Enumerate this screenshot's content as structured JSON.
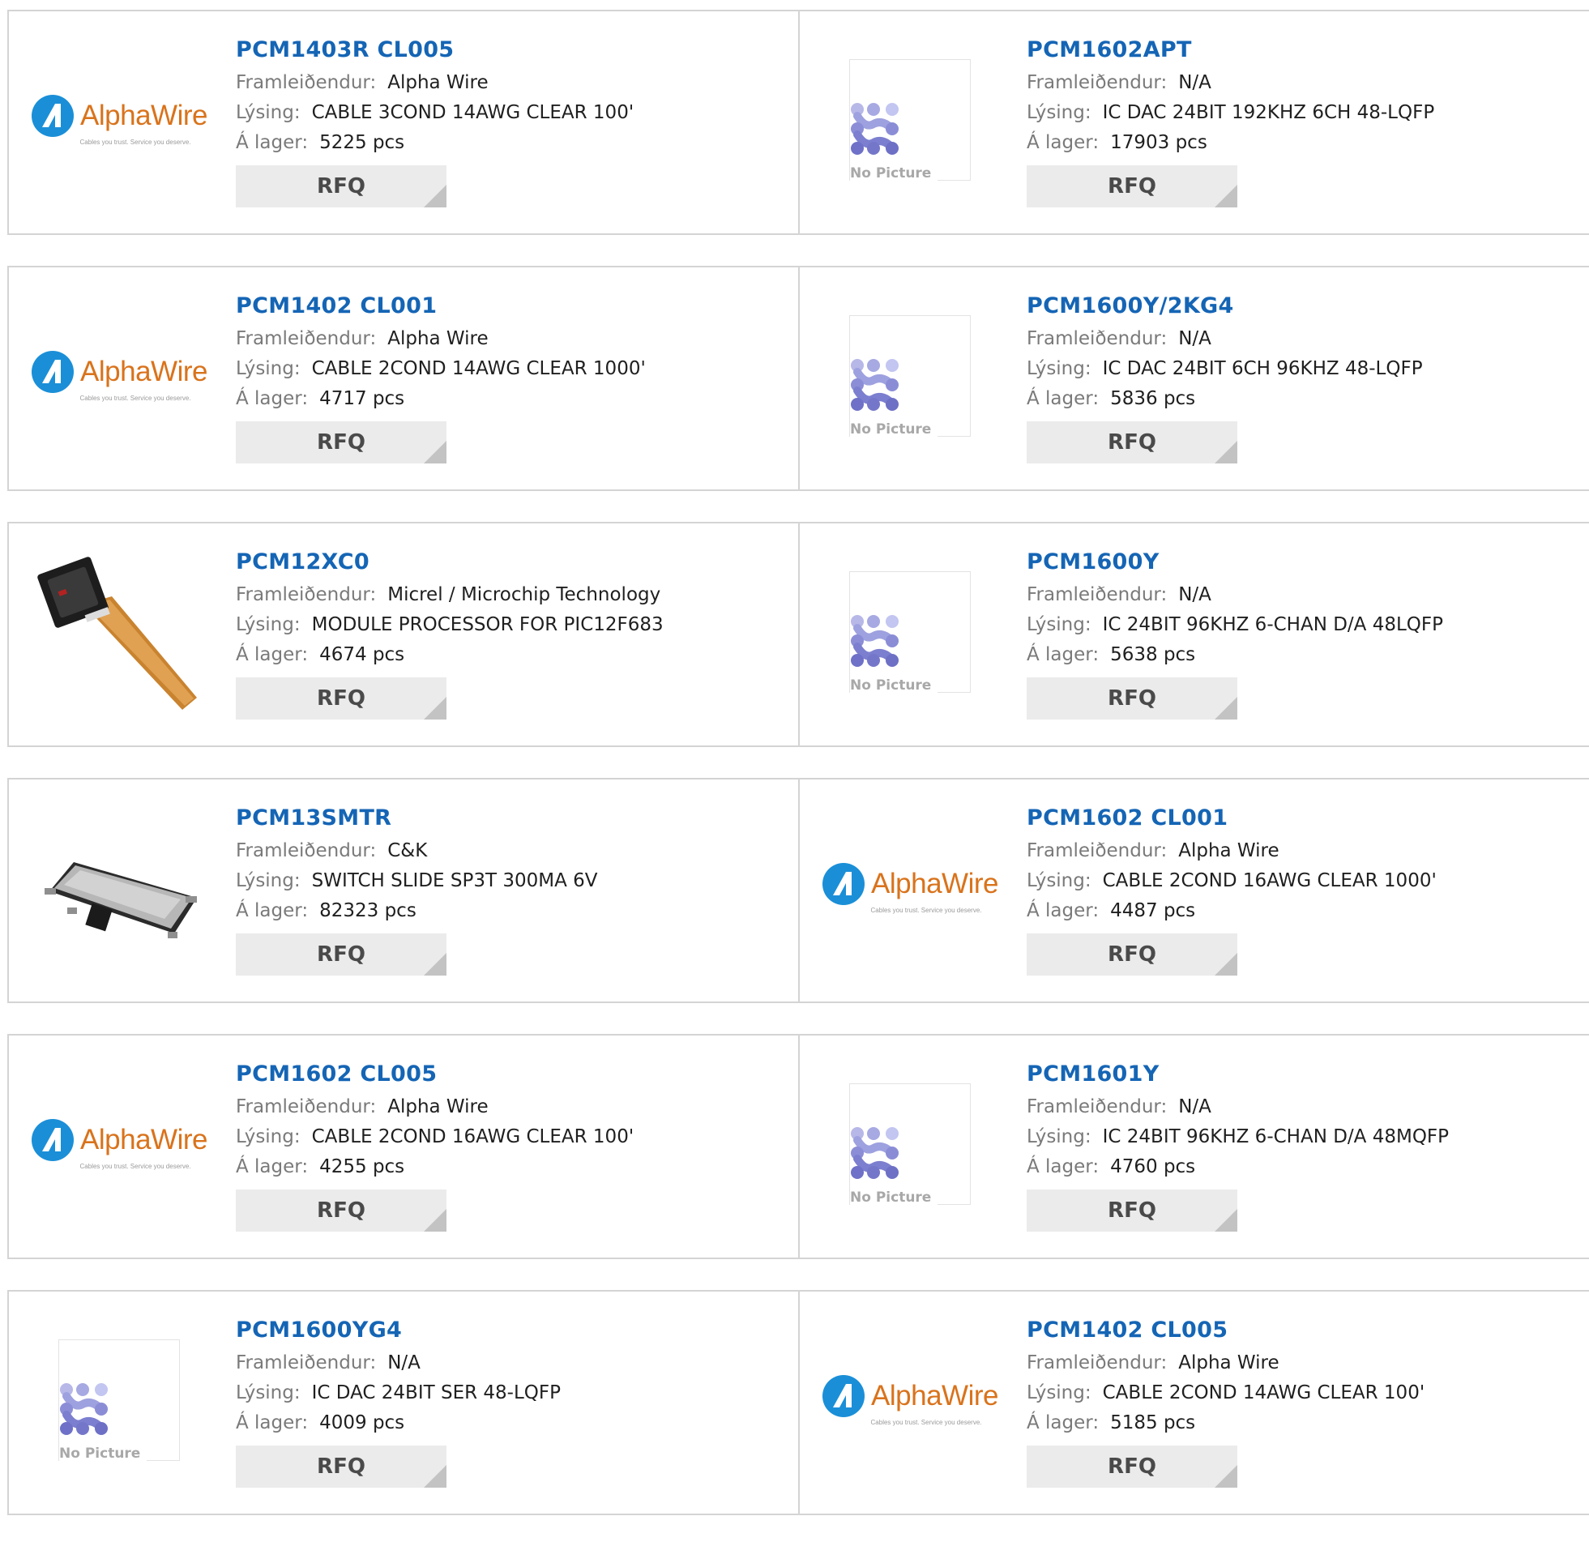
{
  "labels": {
    "manufacturer": "Framleiðendur:",
    "description": "Lýsing:",
    "stock": "Á lager:"
  },
  "rfq_label": "RFQ",
  "alpha_logo": {
    "name": "AlphaWire",
    "tagline": "Cables you trust. Service you deserve."
  },
  "no_picture_text": "No Picture",
  "colors": {
    "title": "#1565b5",
    "logo_blue": "#1a8fd8",
    "logo_orange": "#d9731c",
    "button_bg": "#ebebeb"
  },
  "products": [
    {
      "part": "PCM1403R CL005",
      "manufacturer": "Alpha Wire",
      "description": "CABLE 3COND 14AWG CLEAR 100'",
      "stock": "5225 pcs",
      "image": "alphawire-logo"
    },
    {
      "part": "PCM1602APT",
      "manufacturer": "N/A",
      "description": "IC DAC 24BIT 192KHZ 6CH 48-LQFP",
      "stock": "17903 pcs",
      "image": "no-picture"
    },
    {
      "part": "PCM1402 CL001",
      "manufacturer": "Alpha Wire",
      "description": "CABLE 2COND 14AWG CLEAR 1000'",
      "stock": "4717 pcs",
      "image": "alphawire-logo"
    },
    {
      "part": "PCM1600Y/2KG4",
      "manufacturer": "N/A",
      "description": "IC DAC 24BIT 6CH 96KHZ 48-LQFP",
      "stock": "5836 pcs",
      "image": "no-picture"
    },
    {
      "part": "PCM12XC0",
      "manufacturer": "Micrel / Microchip Technology",
      "description": "MODULE PROCESSOR FOR PIC12F683",
      "stock": "4674 pcs",
      "image": "module-photo"
    },
    {
      "part": "PCM1600Y",
      "manufacturer": "N/A",
      "description": "IC 24BIT 96KHZ 6-CHAN D/A 48LQFP",
      "stock": "5638 pcs",
      "image": "no-picture"
    },
    {
      "part": "PCM13SMTR",
      "manufacturer": "C&K",
      "description": "SWITCH SLIDE SP3T 300MA 6V",
      "stock": "82323 pcs",
      "image": "switch-photo"
    },
    {
      "part": "PCM1602 CL001",
      "manufacturer": "Alpha Wire",
      "description": "CABLE 2COND 16AWG CLEAR 1000'",
      "stock": "4487 pcs",
      "image": "alphawire-logo"
    },
    {
      "part": "PCM1602 CL005",
      "manufacturer": "Alpha Wire",
      "description": "CABLE 2COND 16AWG CLEAR 100'",
      "stock": "4255 pcs",
      "image": "alphawire-logo"
    },
    {
      "part": "PCM1601Y",
      "manufacturer": "N/A",
      "description": "IC 24BIT 96KHZ 6-CHAN D/A 48MQFP",
      "stock": "4760 pcs",
      "image": "no-picture"
    },
    {
      "part": "PCM1600YG4",
      "manufacturer": "N/A",
      "description": "IC DAC 24BIT SER 48-LQFP",
      "stock": "4009 pcs",
      "image": "no-picture"
    },
    {
      "part": "PCM1402 CL005",
      "manufacturer": "Alpha Wire",
      "description": "CABLE 2COND 14AWG CLEAR 100'",
      "stock": "5185 pcs",
      "image": "alphawire-logo"
    }
  ]
}
